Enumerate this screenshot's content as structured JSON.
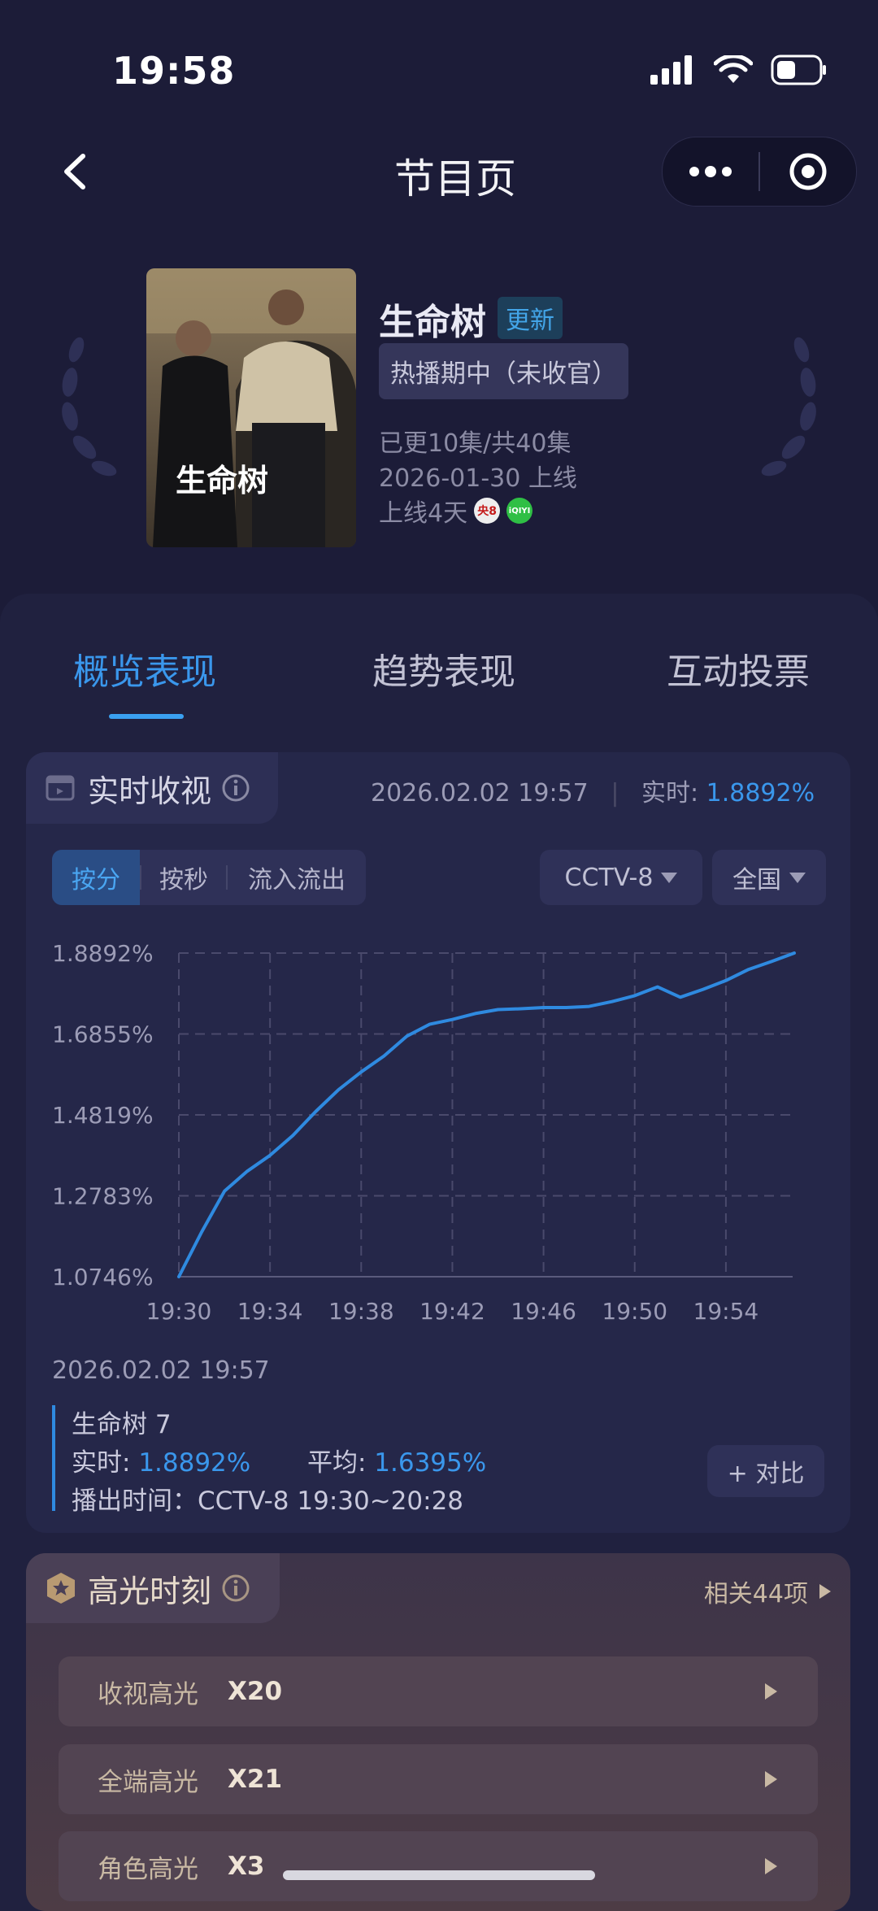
{
  "status_bar": {
    "time": "19:58"
  },
  "nav": {
    "title": "节目页"
  },
  "program": {
    "poster_title": "生命树",
    "title": "生命树",
    "badge": "更新",
    "status": "热播期中（未收官）",
    "episodes": "已更10集/共40集",
    "release": "2026-01-30 上线",
    "online_days": "上线4天",
    "platform_logos": [
      "央8",
      "iQIYI"
    ]
  },
  "tabs": [
    {
      "label": "概览表现",
      "active": true
    },
    {
      "label": "趋势表现",
      "active": false
    },
    {
      "label": "互动投票",
      "active": false
    }
  ],
  "realtime": {
    "title": "实时收视",
    "datetime": "2026.02.02 19:57",
    "live_label": "实时:",
    "live_value": "1.8892%",
    "segments": [
      "按分",
      "按秒",
      "流入流出"
    ],
    "channel": "CCTV-8",
    "region": "全国"
  },
  "chart_data": {
    "type": "line",
    "y_ticks": [
      "1.8892%",
      "1.6855%",
      "1.4819%",
      "1.2783%",
      "1.0746%"
    ],
    "x_ticks": [
      "19:30",
      "19:34",
      "19:38",
      "19:42",
      "19:46",
      "19:50",
      "19:54"
    ],
    "ylim": [
      1.0746,
      1.8892
    ],
    "x_minutes": [
      0,
      1,
      2,
      3,
      4,
      5,
      6,
      7,
      8,
      9,
      10,
      11,
      12,
      13,
      14,
      15,
      16,
      17,
      18,
      19,
      20,
      21,
      22,
      23,
      24,
      25,
      26,
      27
    ],
    "x": [
      "19:30",
      "19:31",
      "19:32",
      "19:33",
      "19:34",
      "19:35",
      "19:36",
      "19:37",
      "19:38",
      "19:39",
      "19:40",
      "19:41",
      "19:42",
      "19:43",
      "19:44",
      "19:45",
      "19:46",
      "19:47",
      "19:48",
      "19:49",
      "19:50",
      "19:51",
      "19:52",
      "19:53",
      "19:54",
      "19:55",
      "19:56",
      "19:57"
    ],
    "series": [
      {
        "name": "生命树 7",
        "color": "#2f8ae0",
        "values": [
          1.0746,
          1.187,
          1.29,
          1.34,
          1.38,
          1.43,
          1.49,
          1.545,
          1.59,
          1.63,
          1.68,
          1.71,
          1.722,
          1.737,
          1.747,
          1.749,
          1.752,
          1.752,
          1.755,
          1.767,
          1.782,
          1.804,
          1.778,
          1.798,
          1.82,
          1.848,
          1.868,
          1.8892
        ]
      }
    ],
    "grid": true
  },
  "detail": {
    "datetime": "2026.02.02 19:57",
    "series_name": "生命树 7",
    "live_label": "实时:",
    "live_value": "1.8892%",
    "avg_label": "平均:",
    "avg_value": "1.6395%",
    "airtime": "播出时间：CCTV-8 19:30~20:28",
    "compare": "+ 对比"
  },
  "highlights": {
    "title": "高光时刻",
    "related": "相关44项",
    "rows": [
      {
        "label": "收视高光",
        "value": "X20"
      },
      {
        "label": "全端高光",
        "value": "X21"
      },
      {
        "label": "角色高光",
        "value": "X3"
      }
    ]
  },
  "colors": {
    "accent": "#3a97ec",
    "bg": "#1c1c38"
  }
}
